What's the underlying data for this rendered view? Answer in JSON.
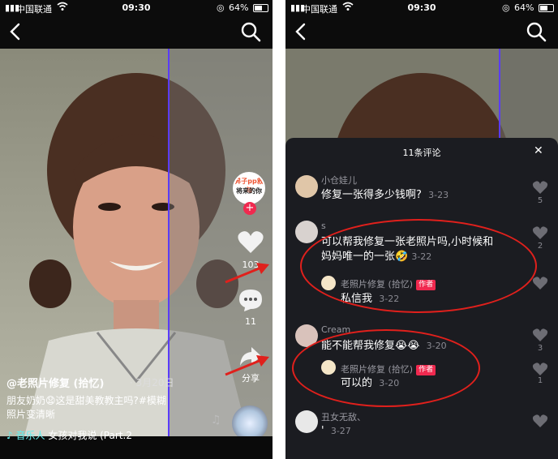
{
  "status": {
    "carrier": "中国联通",
    "time": "09:30",
    "battery": "64%"
  },
  "video": {
    "author": "@老照片修复 (拾忆)",
    "date": "· 3月20日",
    "caption_line1": "朋友奶奶😧这是甜美教教主吗?#模糊",
    "caption_line2": "照片变清晰",
    "music_label": "♪ 音乐人",
    "music_title": "女孩对我说 (Part.2",
    "avatar_text1": "昇子pp救与",
    "avatar_text2": "将来的你",
    "likes": "103",
    "comments": "11",
    "share_label": "分享"
  },
  "panel": {
    "title": "11条评论",
    "comments": [
      {
        "name": "小仓娃儿",
        "text": "修复一张得多少钱啊?",
        "time": "3-23",
        "likes": "5"
      },
      {
        "name": "s",
        "text1": "可以帮我修复一张老照片吗,小时候和",
        "text2": "妈妈唯一的一张🤣",
        "time": "3-22",
        "likes": "2",
        "reply": {
          "name": "老照片修复 (拾忆)",
          "badge": "作者",
          "text": "私信我",
          "time": "3-22"
        }
      },
      {
        "name": "Cream",
        "text": "能不能帮我修复😭😭",
        "time": "3-20",
        "likes": "3",
        "reply": {
          "name": "老照片修复 (拾忆)",
          "badge": "作者",
          "text": "可以的",
          "time": "3-20",
          "likes": "1"
        }
      },
      {
        "name": "丑女无敌、",
        "text": "'",
        "time": "3-27"
      }
    ]
  },
  "colors": {
    "accent": "#f0294f",
    "annotation": "#e0201c",
    "panel_bg": "#1b1c21"
  }
}
